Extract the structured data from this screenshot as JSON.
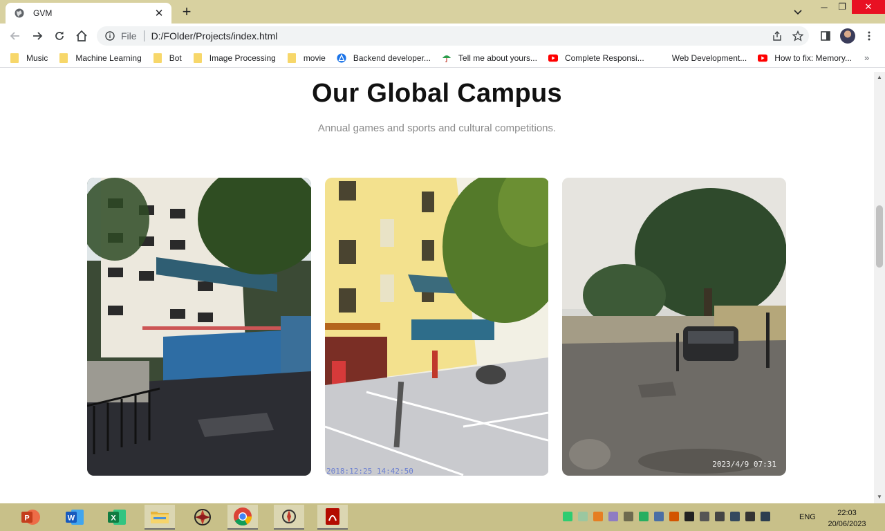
{
  "browser": {
    "tab": {
      "title": "GVM",
      "favicon": "globe-icon"
    },
    "omnibox": {
      "scheme_label": "File",
      "url": "D:/FOlder/Projects/index.html"
    },
    "bookmarks": [
      {
        "label": "Music",
        "icon": "folder-icon"
      },
      {
        "label": "Machine Learning",
        "icon": "folder-icon"
      },
      {
        "label": "Bot",
        "icon": "folder-icon"
      },
      {
        "label": "Image Processing",
        "icon": "folder-icon"
      },
      {
        "label": "movie",
        "icon": "folder-icon"
      },
      {
        "label": "Backend developer...",
        "icon": "site-icon"
      },
      {
        "label": "Tell me about yours...",
        "icon": "umbrella-icon"
      },
      {
        "label": "Complete Responsi...",
        "icon": "youtube-icon"
      },
      {
        "label": "Web Development...",
        "icon": "none"
      },
      {
        "label": "How to fix: Memory...",
        "icon": "youtube-icon"
      }
    ],
    "more_label": "»"
  },
  "page": {
    "title": "Our Global Campus",
    "subtitle": "Annual games and sports and cultural competitions.",
    "cards": [
      {
        "name": "campus-building-gate",
        "stamp": ""
      },
      {
        "name": "campus-courtyard",
        "stamp": "2018:12:25 14:42:50"
      },
      {
        "name": "campus-ground",
        "stamp": "2023/4/9  07:31"
      }
    ]
  },
  "taskbar": {
    "apps": [
      "powerpoint-icon",
      "word-icon",
      "excel-icon",
      "file-explorer-icon",
      "app-icon",
      "chrome-icon",
      "app-icon",
      "pdf-icon"
    ],
    "language": "ENG",
    "time": "22:03",
    "date": "20/06/2023"
  },
  "colors": {
    "tabstrip": "#d8d1a0",
    "taskbar": "#c8c089",
    "close": "#e81123"
  }
}
